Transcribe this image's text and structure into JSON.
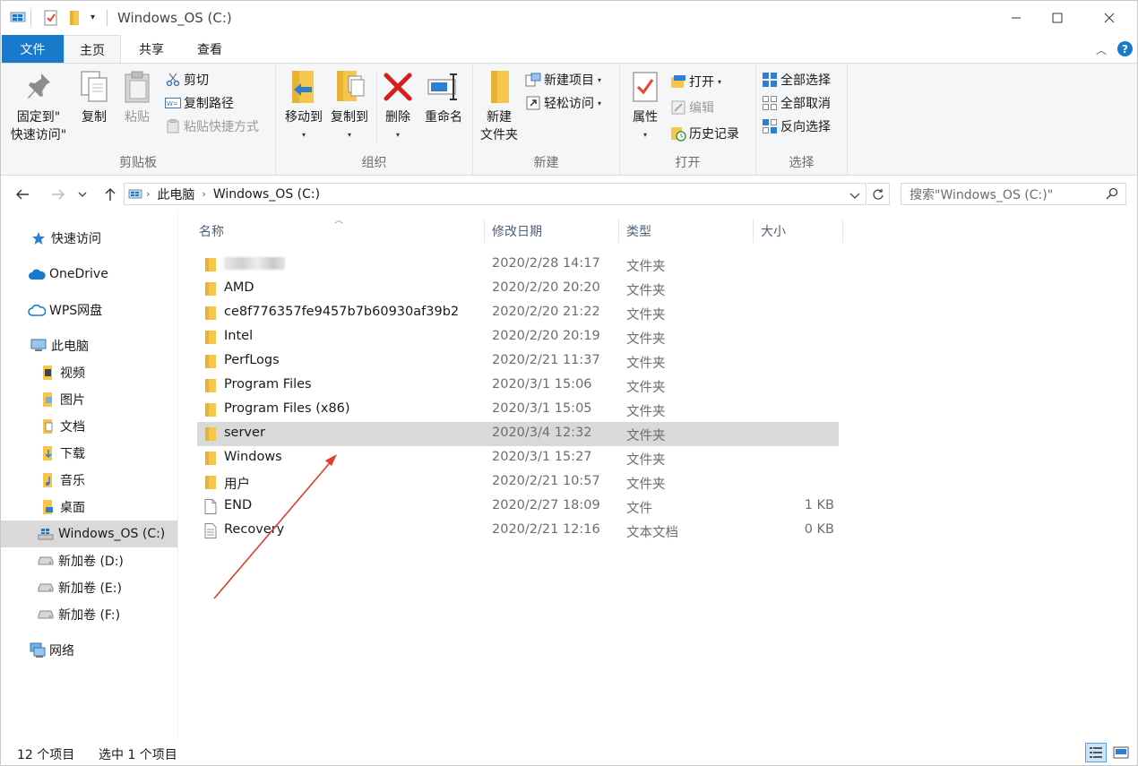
{
  "window": {
    "title": "Windows_OS (C:)"
  },
  "ribbon_tabs": {
    "file": "文件",
    "home": "主页",
    "share": "共享",
    "view": "查看"
  },
  "ribbon": {
    "clipboard": {
      "label": "剪贴板",
      "pin_line1": "固定到\"",
      "pin_line2": "快速访问\"",
      "copy": "复制",
      "paste": "粘贴",
      "cut": "剪切",
      "copy_path": "复制路径",
      "paste_shortcut": "粘贴快捷方式"
    },
    "organize": {
      "label": "组织",
      "move_to": "移动到",
      "copy_to": "复制到",
      "delete": "删除",
      "rename": "重命名"
    },
    "new": {
      "label": "新建",
      "new_folder_line1": "新建",
      "new_folder_line2": "文件夹",
      "new_item": "新建项目",
      "easy_access": "轻松访问"
    },
    "open": {
      "label": "打开",
      "properties": "属性",
      "open": "打开",
      "edit": "编辑",
      "history": "历史记录"
    },
    "select": {
      "label": "选择",
      "select_all": "全部选择",
      "select_none": "全部取消",
      "invert": "反向选择"
    }
  },
  "address": {
    "crumbs": [
      "此电脑",
      "Windows_OS (C:)"
    ],
    "search_placeholder": "搜索\"Windows_OS (C:)\""
  },
  "nav": {
    "quick_access": "快速访问",
    "onedrive": "OneDrive",
    "wps": "WPS网盘",
    "this_pc": "此电脑",
    "videos": "视频",
    "pictures": "图片",
    "documents": "文档",
    "downloads": "下载",
    "music": "音乐",
    "desktop": "桌面",
    "drive_c": "Windows_OS (C:)",
    "drive_d": "新加卷 (D:)",
    "drive_e": "新加卷 (E:)",
    "drive_f": "新加卷 (F:)",
    "network": "网络"
  },
  "columns": {
    "name": "名称",
    "modified": "修改日期",
    "type": "类型",
    "size": "大小"
  },
  "files": [
    {
      "name": "",
      "date": "2020/2/28 14:17",
      "type": "文件夹",
      "size": ""
    },
    {
      "name": "AMD",
      "date": "2020/2/20 20:20",
      "type": "文件夹",
      "size": ""
    },
    {
      "name": "ce8f776357fe9457b7b60930af39b2",
      "date": "2020/2/20 21:22",
      "type": "文件夹",
      "size": ""
    },
    {
      "name": "Intel",
      "date": "2020/2/20 20:19",
      "type": "文件夹",
      "size": ""
    },
    {
      "name": "PerfLogs",
      "date": "2020/2/21 11:37",
      "type": "文件夹",
      "size": ""
    },
    {
      "name": "Program Files",
      "date": "2020/3/1 15:06",
      "type": "文件夹",
      "size": ""
    },
    {
      "name": "Program Files (x86)",
      "date": "2020/3/1 15:05",
      "type": "文件夹",
      "size": ""
    },
    {
      "name": "server",
      "date": "2020/3/4 12:32",
      "type": "文件夹",
      "size": ""
    },
    {
      "name": "Windows",
      "date": "2020/3/1 15:27",
      "type": "文件夹",
      "size": ""
    },
    {
      "name": "用户",
      "date": "2020/2/21 10:57",
      "type": "文件夹",
      "size": ""
    },
    {
      "name": "END",
      "date": "2020/2/27 18:09",
      "type": "文件",
      "size": "1 KB"
    },
    {
      "name": "Recovery",
      "date": "2020/2/21 12:16",
      "type": "文本文档",
      "size": "0 KB"
    }
  ],
  "status": {
    "item_count": "12 个项目",
    "selected": "选中 1 个项目"
  },
  "colors": {
    "accent": "#1979ca",
    "selection": "#d9d9d9",
    "annotation_arrow": "#e03c31",
    "folder": "#f6c64a"
  }
}
